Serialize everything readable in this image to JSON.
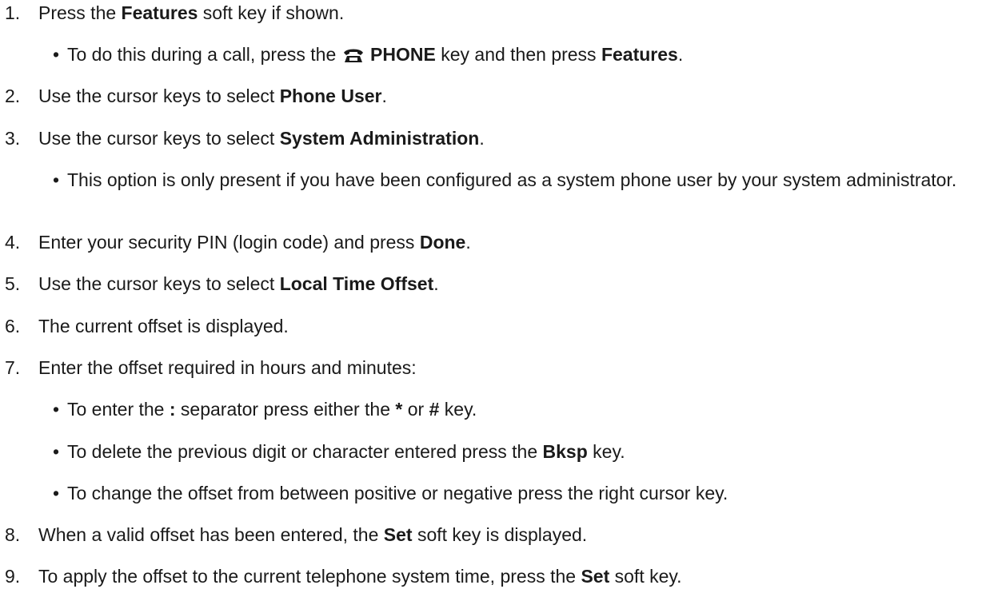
{
  "steps": [
    {
      "num": "1.",
      "pre": "Press the ",
      "bold": "Features",
      "post": " soft key if shown."
    },
    {
      "num": "2.",
      "pre": "Use the cursor keys to select ",
      "bold": "Phone User",
      "post": "."
    },
    {
      "num": "3.",
      "pre": "Use the cursor keys to select ",
      "bold": "System Administration",
      "post": "."
    },
    {
      "num": "4.",
      "pre": "Enter your security PIN (login code) and press ",
      "bold": "Done",
      "post": "."
    },
    {
      "num": "5.",
      "pre": "Use the cursor keys to select ",
      "bold": "Local Time Offset",
      "post": "."
    },
    {
      "num": "6.",
      "text": "The current offset is displayed."
    },
    {
      "num": "7.",
      "text": "Enter the offset required in hours and minutes:"
    },
    {
      "num": "8.",
      "pre": "When a valid offset has been entered, the ",
      "bold": "Set",
      "post": " soft key is displayed."
    },
    {
      "num": "9.",
      "pre": "To apply the offset to the current telephone system time, press the ",
      "bold": "Set",
      "post": " soft key."
    }
  ],
  "bullets": {
    "b1": {
      "pre": "To do this during a call, press the ",
      "bold1": "PHONE",
      "mid": " key and then press ",
      "bold2": "Features",
      "post": "."
    },
    "b3": {
      "text": "This option is only present if you have been configured as a system phone user by your system administrator."
    },
    "b7a": {
      "pre": "To enter the ",
      "bold1": ":",
      "mid1": " separator press either the ",
      "bold2": "*",
      "mid2": " or ",
      "bold3": "#",
      "post": " key."
    },
    "b7b": {
      "pre": "To delete the previous digit or character entered press the ",
      "bold": "Bksp",
      "post": " key."
    },
    "b7c": {
      "text": "To change the offset from between positive or negative press the right cursor key."
    }
  },
  "bullet_glyph": "•",
  "icons": {
    "phone": "phone-icon"
  }
}
